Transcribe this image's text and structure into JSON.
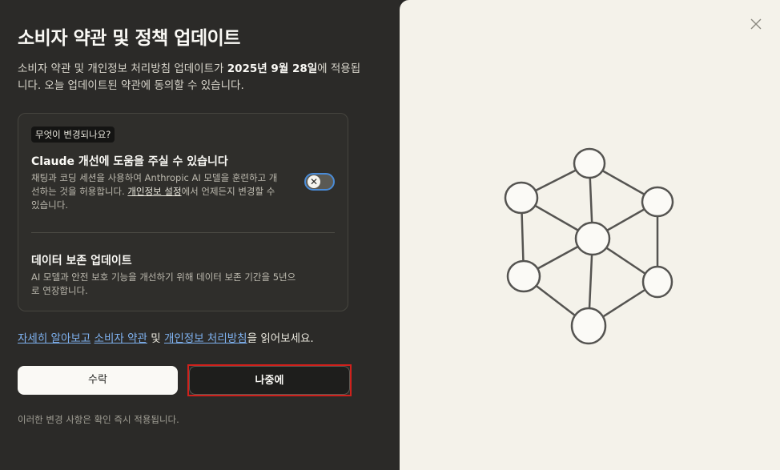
{
  "dialog": {
    "title": "소비자 약관 및 정책 업데이트",
    "intro_part1": "소비자 약관 및 개인정보 처리방침 업데이트가 ",
    "intro_date": "2025년 9월 28일",
    "intro_part2": "에 적용됩니다. 오늘 업데이트된 약관에 동의할 수 있습니다."
  },
  "card": {
    "tag": "무엇이 변경되나요?",
    "section1": {
      "title": "Claude 개선에 도움을 주실 수 있습니다",
      "text_part1": "채팅과 코딩 세션을 사용하여 Anthropic AI 모델을 훈련하고 개선하는 것을 허용합니다. ",
      "link": "개인정보 설정",
      "text_part2": "에서 언제든지 변경할 수 있습니다.",
      "toggle_state": "off"
    },
    "section2": {
      "title": "데이터 보존 업데이트",
      "text": "AI 모델과 안전 보호 기능을 개선하기 위해 데이터 보존 기간을 5년으로 연장합니다."
    }
  },
  "links": {
    "learn_more": "자세히 알아보고",
    "terms": "소비자 약관",
    "and": " 및 ",
    "privacy": "개인정보 처리방침",
    "suffix": "을 읽어보세요."
  },
  "buttons": {
    "accept": "수락",
    "later": "나중에"
  },
  "footnote": "이러한 변경 사항은 확인 즉시 적용됩니다.",
  "colors": {
    "accent_highlight": "#d0211c",
    "link": "#7fb2f0",
    "toggle_ring": "#4a8bd6"
  },
  "icons": {
    "close": "close-icon",
    "toggle_knob": "x-icon",
    "illustration": "network-graph-illustration"
  }
}
